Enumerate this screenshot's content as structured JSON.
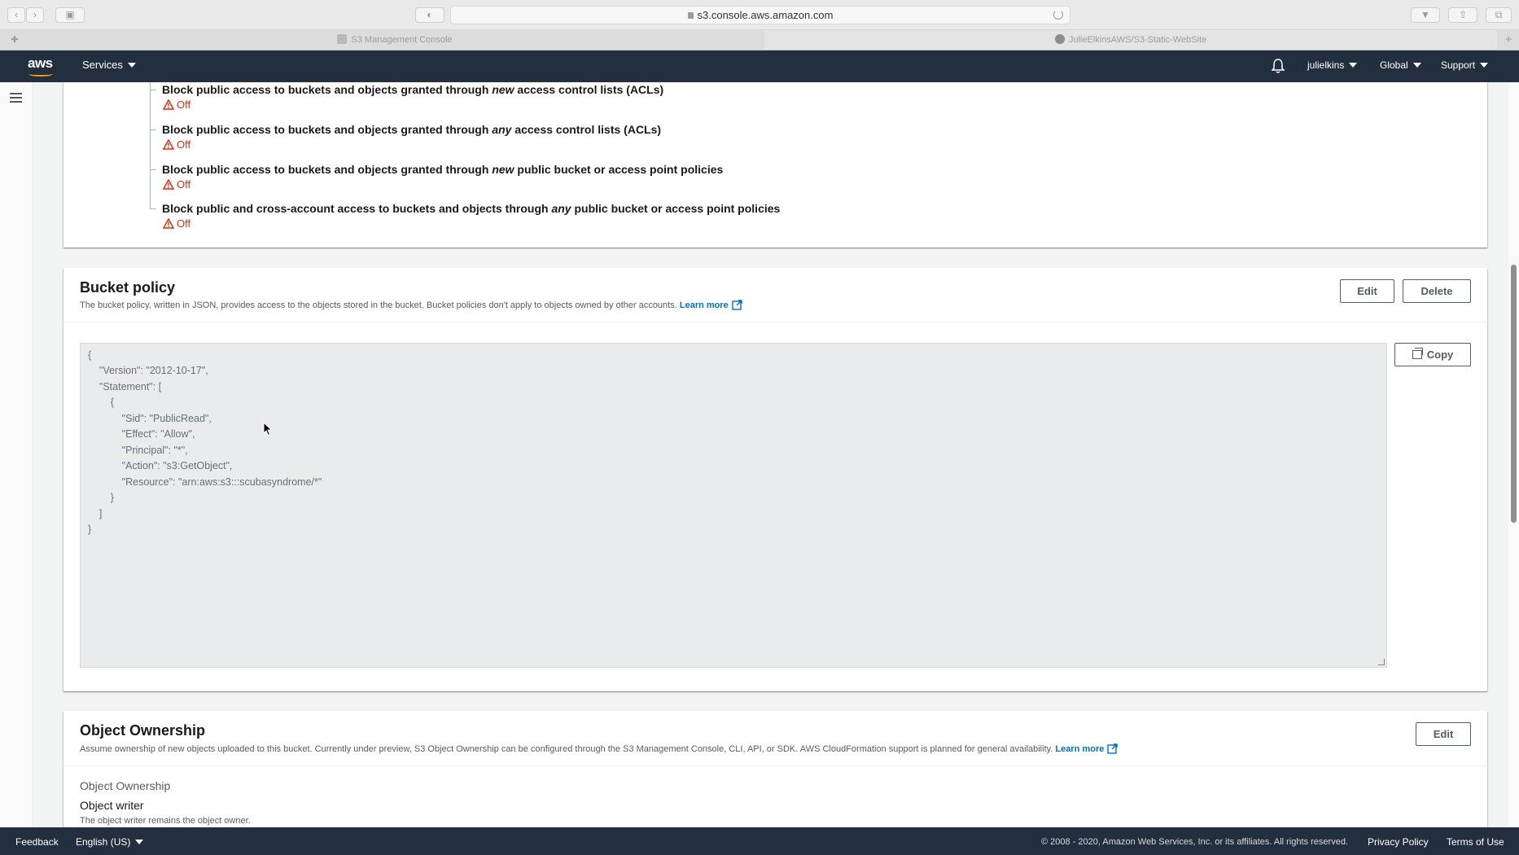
{
  "browser": {
    "url": "s3.console.aws.amazon.com",
    "tabs": [
      {
        "label": "S3 Management Console",
        "active": false
      },
      {
        "label": "JulieElkinsAWS/S3-Static-WebSite",
        "active": true
      }
    ]
  },
  "nav": {
    "logo": "aws",
    "services": "Services",
    "user": "julielkins",
    "region": "Global",
    "support": "Support"
  },
  "block_public_access": {
    "settings": [
      {
        "pre": "Block public access to buckets and objects granted through ",
        "em": "new",
        "post": " access control lists (ACLs)",
        "status": "Off"
      },
      {
        "pre": "Block public access to buckets and objects granted through ",
        "em": "any",
        "post": " access control lists (ACLs)",
        "status": "Off"
      },
      {
        "pre": "Block public access to buckets and objects granted through ",
        "em": "new",
        "post": " public bucket or access point policies",
        "status": "Off"
      },
      {
        "pre": "Block public and cross-account access to buckets and objects through ",
        "em": "any",
        "post": " public bucket or access point policies",
        "status": "Off"
      }
    ]
  },
  "bucket_policy": {
    "title": "Bucket policy",
    "description": "The bucket policy, written in JSON, provides access to the objects stored in the bucket. Bucket policies don't apply to objects owned by other accounts.",
    "learn_more": "Learn more",
    "edit_label": "Edit",
    "delete_label": "Delete",
    "copy_label": "Copy",
    "policy_lines": [
      "{",
      "    \"Version\": \"2012-10-17\",",
      "    \"Statement\": [",
      "        {",
      "            \"Sid\": \"PublicRead\",",
      "            \"Effect\": \"Allow\",",
      "            \"Principal\": \"*\",",
      "            \"Action\": \"s3:GetObject\",",
      "            \"Resource\": \"arn:aws:s3:::scubasyndrome/*\"",
      "        }",
      "    ]",
      "}"
    ]
  },
  "object_ownership": {
    "title": "Object Ownership",
    "description": "Assume ownership of new objects uploaded to this bucket. Currently under preview, S3 Object Ownership can be configured through the S3 Management Console, CLI, API, or SDK. AWS CloudFormation support is planned for general availability.",
    "learn_more": "Learn more",
    "edit_label": "Edit",
    "field_label": "Object Ownership",
    "field_value": "Object writer",
    "field_desc": "The object writer remains the object owner."
  },
  "footer": {
    "feedback": "Feedback",
    "language": "English (US)",
    "copyright": "© 2008 - 2020, Amazon Web Services, Inc. or its affiliates. All rights reserved.",
    "privacy": "Privacy Policy",
    "terms": "Terms of Use"
  },
  "colors": {
    "nav_bg": "#232f3e",
    "accent": "#ff9900",
    "link": "#0073bb",
    "error": "#d13212"
  },
  "icons": [
    "back-icon",
    "forward-icon",
    "sidebar-icon",
    "lock-icon",
    "reload-icon",
    "bell-icon",
    "hamburger-icon",
    "warning-icon",
    "external-link-icon",
    "copy-icon",
    "github-icon"
  ]
}
